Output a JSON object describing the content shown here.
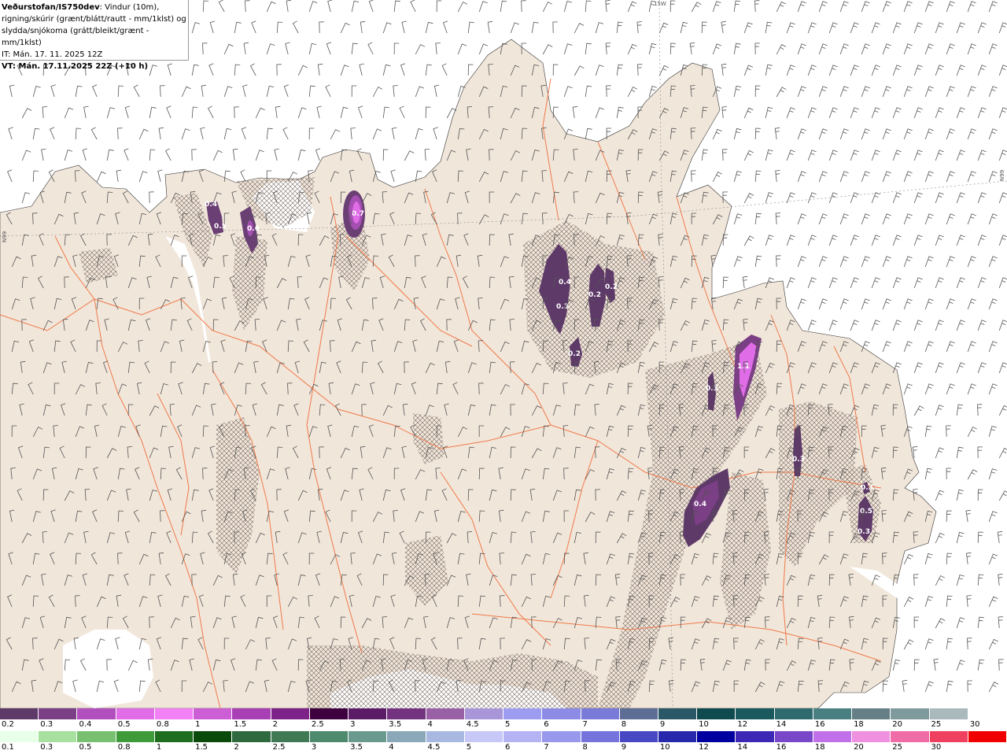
{
  "header": {
    "line1_bold": "Veðurstofan/IS750dev",
    "line1_rest": ": Vindur (10m),",
    "line2": "rigning/skúrir (grænt/blátt/rautt - mm/1klst) og",
    "line3": "slydda/snjókoma (grátt/bleikt/grænt - mm/1klst)",
    "line4": "IT: Mán. 17. 11. 2025 12Z",
    "line5": "VT: Mán. 17.11.2025 22Z (+10 h)"
  },
  "graticule": {
    "lon_label_top": "15W",
    "lat_label_left": "N99",
    "lat_label_right": "N99"
  },
  "colors": {
    "land": "#f1e6da",
    "sea": "#ffffff",
    "roads": "#f07a4a",
    "wind_barbs": "#555555",
    "precip_dark": "#5e3a68",
    "precip_mid": "#8b4a96",
    "precip_light": "#e06ce8"
  },
  "precip_labels": [
    {
      "text": "0.4"
    },
    {
      "text": "0.5"
    },
    {
      "text": "0.6"
    },
    {
      "text": "0.7"
    },
    {
      "text": "0.4"
    },
    {
      "text": "0.3"
    },
    {
      "text": "0.2"
    },
    {
      "text": "0.2"
    },
    {
      "text": "0.2"
    },
    {
      "text": "1.1"
    },
    {
      "text": "0.3"
    },
    {
      "text": "0.3"
    },
    {
      "text": "0.4"
    },
    {
      "text": "0.5"
    },
    {
      "text": "0.3"
    },
    {
      "text": "0.3"
    }
  ],
  "snow_scale": {
    "colors": [
      "#5e3a68",
      "#7a3f84",
      "#b14fbf",
      "#e06ce8",
      "#f281f5",
      "#cc5fd6",
      "#a93fb5",
      "#7d2288",
      "#3f0040",
      "#5b1b66",
      "#74337f",
      "#9a60a6",
      "#a996d8",
      "#9c9cf0",
      "#8c8ce6",
      "#7a7ad8",
      "#5d6d95",
      "#2a5866",
      "#0f4a4f",
      "#1a5a5f",
      "#2f6a6f",
      "#4a7f82",
      "#667f86",
      "#7f9a9d",
      "#aab9bc",
      "#ffffff"
    ],
    "labels": [
      "0.2",
      "0.3",
      "0.4",
      "0.5",
      "0.8",
      "1",
      "1.5",
      "2",
      "2.5",
      "3",
      "3.5",
      "4",
      "4.5",
      "5",
      "6",
      "7",
      "8",
      "9",
      "10",
      "12",
      "14",
      "16",
      "18",
      "20",
      "25",
      "30"
    ]
  },
  "rain_scale": {
    "colors": [
      "#e8ffe8",
      "#a8e0a0",
      "#78c070",
      "#3f9a3a",
      "#1f6e1f",
      "#0a4a0a",
      "#2e6a3e",
      "#3f7a55",
      "#4e8a6e",
      "#6a9a8e",
      "#8aa8b8",
      "#a8b8e0",
      "#c8c8f8",
      "#b4b4f4",
      "#9898ec",
      "#7474dc",
      "#4848c4",
      "#2828ac",
      "#0000a0",
      "#3c28b4",
      "#7848c8",
      "#c070e8",
      "#f090e0",
      "#f06ca8",
      "#f04060",
      "#f00000"
    ],
    "labels": [
      "0.1",
      "0.3",
      "0.5",
      "0.8",
      "1",
      "1.5",
      "2",
      "2.5",
      "3",
      "3.5",
      "4",
      "4.5",
      "5",
      "6",
      "7",
      "8",
      "9",
      "10",
      "12",
      "14",
      "16",
      "18",
      "20",
      "25",
      "30"
    ]
  }
}
